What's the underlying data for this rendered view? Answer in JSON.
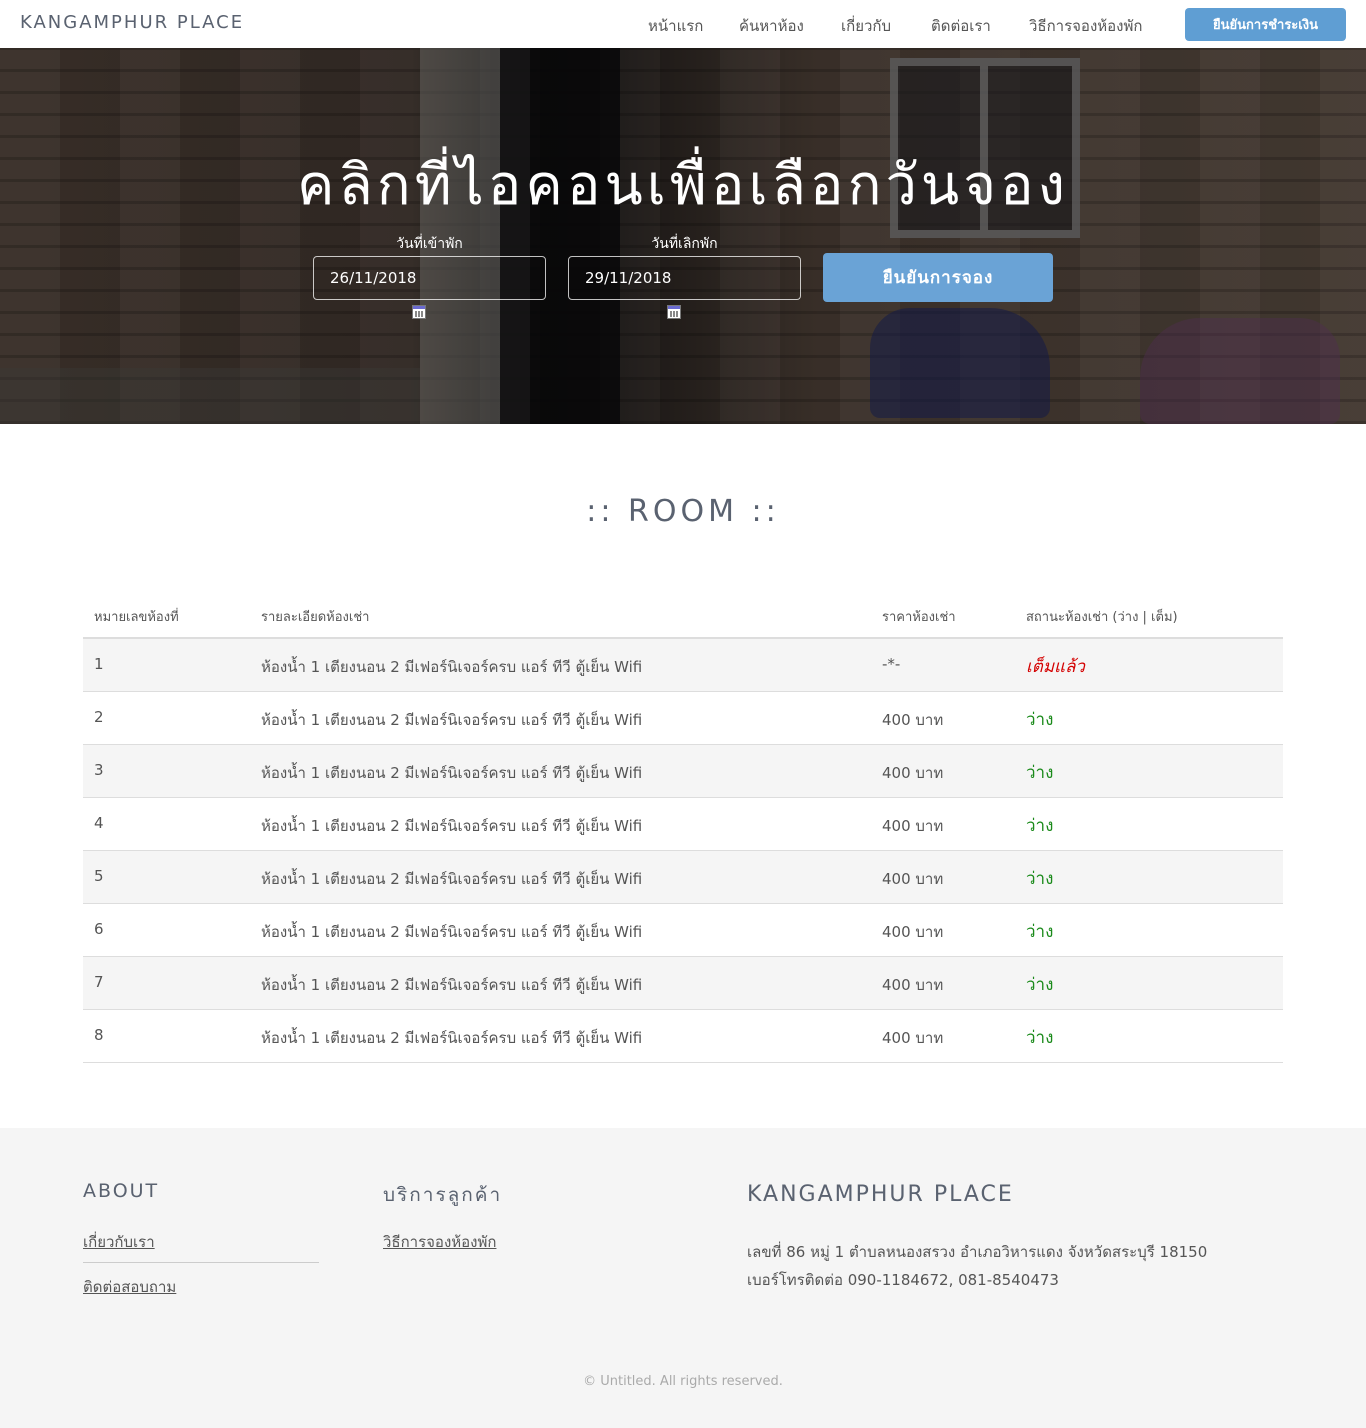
{
  "navbar": {
    "brand": "KANGAMPHUR PLACE",
    "links": [
      "หน้าแรก",
      "ค้นหาห้อง",
      "เกี่ยวกับ",
      "ติดต่อเรา",
      "วิธีการจองห้องพัก"
    ],
    "pay_button": "ยืนยันการชำระเงิน"
  },
  "hero": {
    "title": "คลิกที่ไอคอนเพื่อเลือกวันจอง",
    "checkin_label": "วันที่เข้าพัก",
    "checkin_value": "26/11/2018",
    "checkout_label": "วันที่เลิกพัก",
    "checkout_value": "29/11/2018",
    "confirm_button": "ยืนยันการจอง"
  },
  "rooms": {
    "section_title": ":: ROOM ::",
    "headers": [
      "หมายเลขห้องที่",
      "รายละเอียดห้องเช่า",
      "ราคาห้องเช่า",
      "สถานะห้องเช่า (ว่าง | เต็ม)"
    ],
    "rows": [
      {
        "number": "1",
        "detail": "ห้องน้ำ 1 เตียงนอน 2 มีเฟอร์นิเจอร์ครบ แอร์ ทีวี ตู้เย็น Wifi",
        "price": "-*-",
        "status": "เต็มแล้ว"
      },
      {
        "number": "2",
        "detail": "ห้องน้ำ 1 เตียงนอน 2 มีเฟอร์นิเจอร์ครบ แอร์ ทีวี ตู้เย็น Wifi",
        "price": "400 บาท",
        "status": "ว่าง"
      },
      {
        "number": "3",
        "detail": "ห้องน้ำ 1 เตียงนอน 2 มีเฟอร์นิเจอร์ครบ แอร์ ทีวี ตู้เย็น Wifi",
        "price": "400 บาท",
        "status": "ว่าง"
      },
      {
        "number": "4",
        "detail": "ห้องน้ำ 1 เตียงนอน 2 มีเฟอร์นิเจอร์ครบ แอร์ ทีวี ตู้เย็น Wifi",
        "price": "400 บาท",
        "status": "ว่าง"
      },
      {
        "number": "5",
        "detail": "ห้องน้ำ 1 เตียงนอน 2 มีเฟอร์นิเจอร์ครบ แอร์ ทีวี ตู้เย็น Wifi",
        "price": "400 บาท",
        "status": "ว่าง"
      },
      {
        "number": "6",
        "detail": "ห้องน้ำ 1 เตียงนอน 2 มีเฟอร์นิเจอร์ครบ แอร์ ทีวี ตู้เย็น Wifi",
        "price": "400 บาท",
        "status": "ว่าง"
      },
      {
        "number": "7",
        "detail": "ห้องน้ำ 1 เตียงนอน 2 มีเฟอร์นิเจอร์ครบ แอร์ ทีวี ตู้เย็น Wifi",
        "price": "400 บาท",
        "status": "ว่าง"
      },
      {
        "number": "8",
        "detail": "ห้องน้ำ 1 เตียงนอน 2 มีเฟอร์นิเจอร์ครบ แอร์ ทีวี ตู้เย็น Wifi",
        "price": "400 บาท",
        "status": "ว่าง"
      }
    ]
  },
  "footer": {
    "about_heading": "ABOUT",
    "about_links": [
      "เกี่ยวกับเรา",
      "ติดต่อสอบถาม"
    ],
    "service_heading": "บริการลูกค้า",
    "service_links": [
      "วิธีการจองห้องพัก"
    ],
    "brand_heading": "KANGAMPHUR PLACE",
    "address": "เลขที่ 86 หมู่ 1 ตำบลหนองสรวง อำเภอวิหารแดง จังหวัดสระบุรี 18150",
    "phone": "เบอร์โทรติดต่อ 090-1184672, 081-8540473",
    "copyright": "© Untitled. All rights reserved."
  },
  "colors": {
    "accent": "#5f9ed3",
    "status_full": "#d40000",
    "status_free": "#1a8a1a"
  },
  "icons": [
    "calendar-icon"
  ]
}
